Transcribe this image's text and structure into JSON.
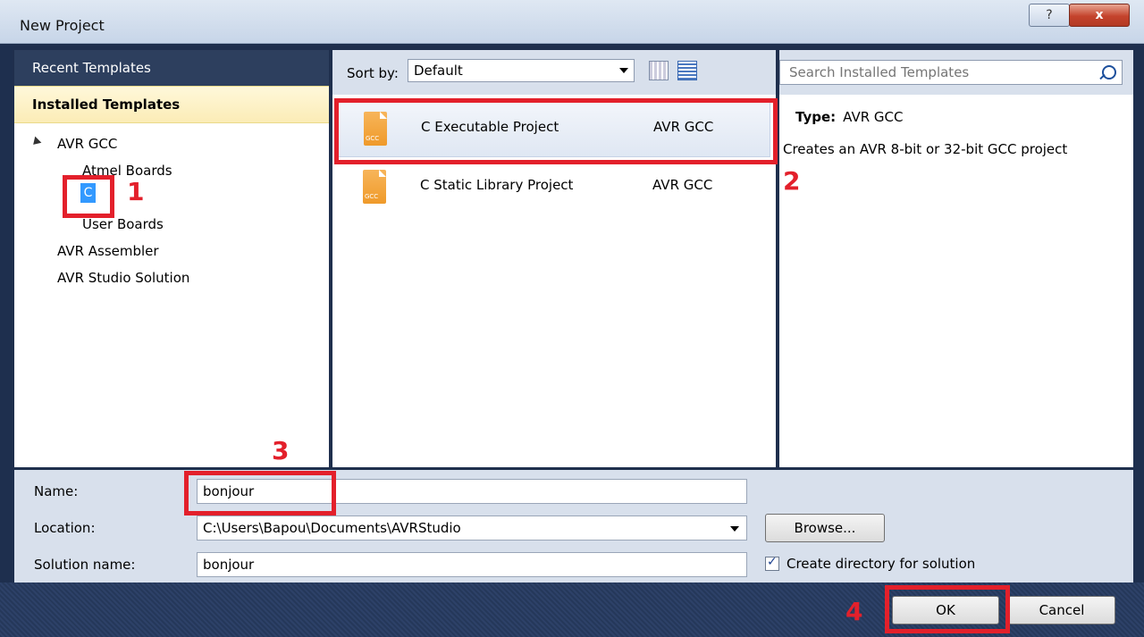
{
  "window": {
    "title": "New Project",
    "help_glyph": "?",
    "close_glyph": "x"
  },
  "sidebar": {
    "recent": "Recent Templates",
    "installed": "Installed Templates",
    "items": [
      {
        "label": "AVR GCC"
      },
      {
        "label": "Atmel Boards"
      },
      {
        "label": "C"
      },
      {
        "label": "User Boards"
      },
      {
        "label": "AVR Assembler"
      },
      {
        "label": "AVR Studio Solution"
      }
    ]
  },
  "toolbar": {
    "sort_label": "Sort by:",
    "sort_value": "Default"
  },
  "search": {
    "placeholder": "Search Installed Templates"
  },
  "templates": [
    {
      "name": "C Executable Project",
      "type": "AVR GCC",
      "icon_text": "GCC"
    },
    {
      "name": "C Static Library Project",
      "type": "AVR GCC",
      "icon_text": "GCC"
    }
  ],
  "details": {
    "type_label": "Type:",
    "type_value": "AVR GCC",
    "description": "Creates an AVR 8-bit or 32-bit GCC project"
  },
  "form": {
    "name_label": "Name:",
    "name_value": "bonjour",
    "location_label": "Location:",
    "location_value": "C:\\Users\\Bapou\\Documents\\AVRStudio",
    "solution_label": "Solution name:",
    "solution_value": "bonjour",
    "browse": "Browse...",
    "create_dir": "Create directory for solution",
    "create_dir_checked": true
  },
  "buttons": {
    "ok": "OK",
    "cancel": "Cancel"
  },
  "annotations": [
    "1",
    "2",
    "3",
    "4"
  ],
  "colors": {
    "annotation_red": "#e3202b",
    "selection_blue": "#3399ff",
    "installed_header": "#fbecb6",
    "file_icon": "#ef9a2a"
  }
}
